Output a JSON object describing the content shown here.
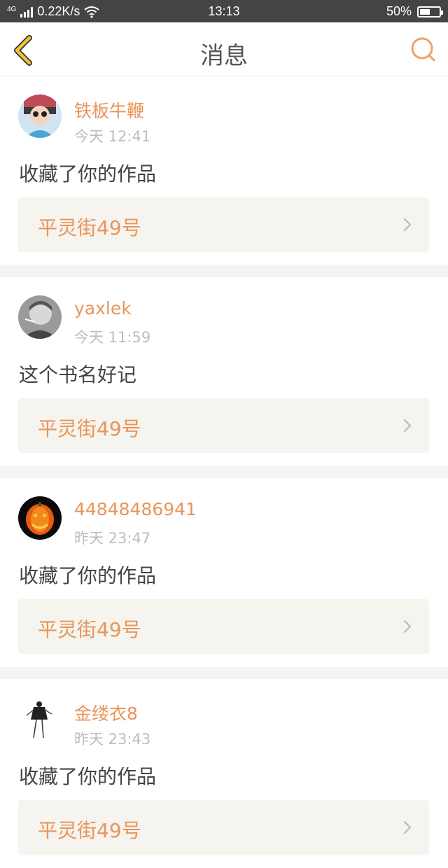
{
  "status_bar": {
    "network": "4G",
    "speed": "0.22K/s",
    "time": "13:13",
    "battery": "50%"
  },
  "header": {
    "title": "消息",
    "back_icon": "chevron-left-icon",
    "search_icon": "search-icon"
  },
  "colors": {
    "accent": "#e8955a",
    "back": "#f0c33c",
    "card_bg": "#f5f4ee"
  },
  "messages": [
    {
      "user": "铁板牛鞭",
      "time": "今天 12:41",
      "text": "收藏了你的作品",
      "work": "平灵街49号"
    },
    {
      "user": "yaxlek",
      "time": "今天 11:59",
      "text": "这个书名好记",
      "work": "平灵街49号"
    },
    {
      "user": "44848486941",
      "time": "昨天 23:47",
      "text": "收藏了你的作品",
      "work": "平灵街49号"
    },
    {
      "user": "金缕衣8",
      "time": "昨天 23:43",
      "text": "收藏了你的作品",
      "work": "平灵街49号"
    }
  ]
}
